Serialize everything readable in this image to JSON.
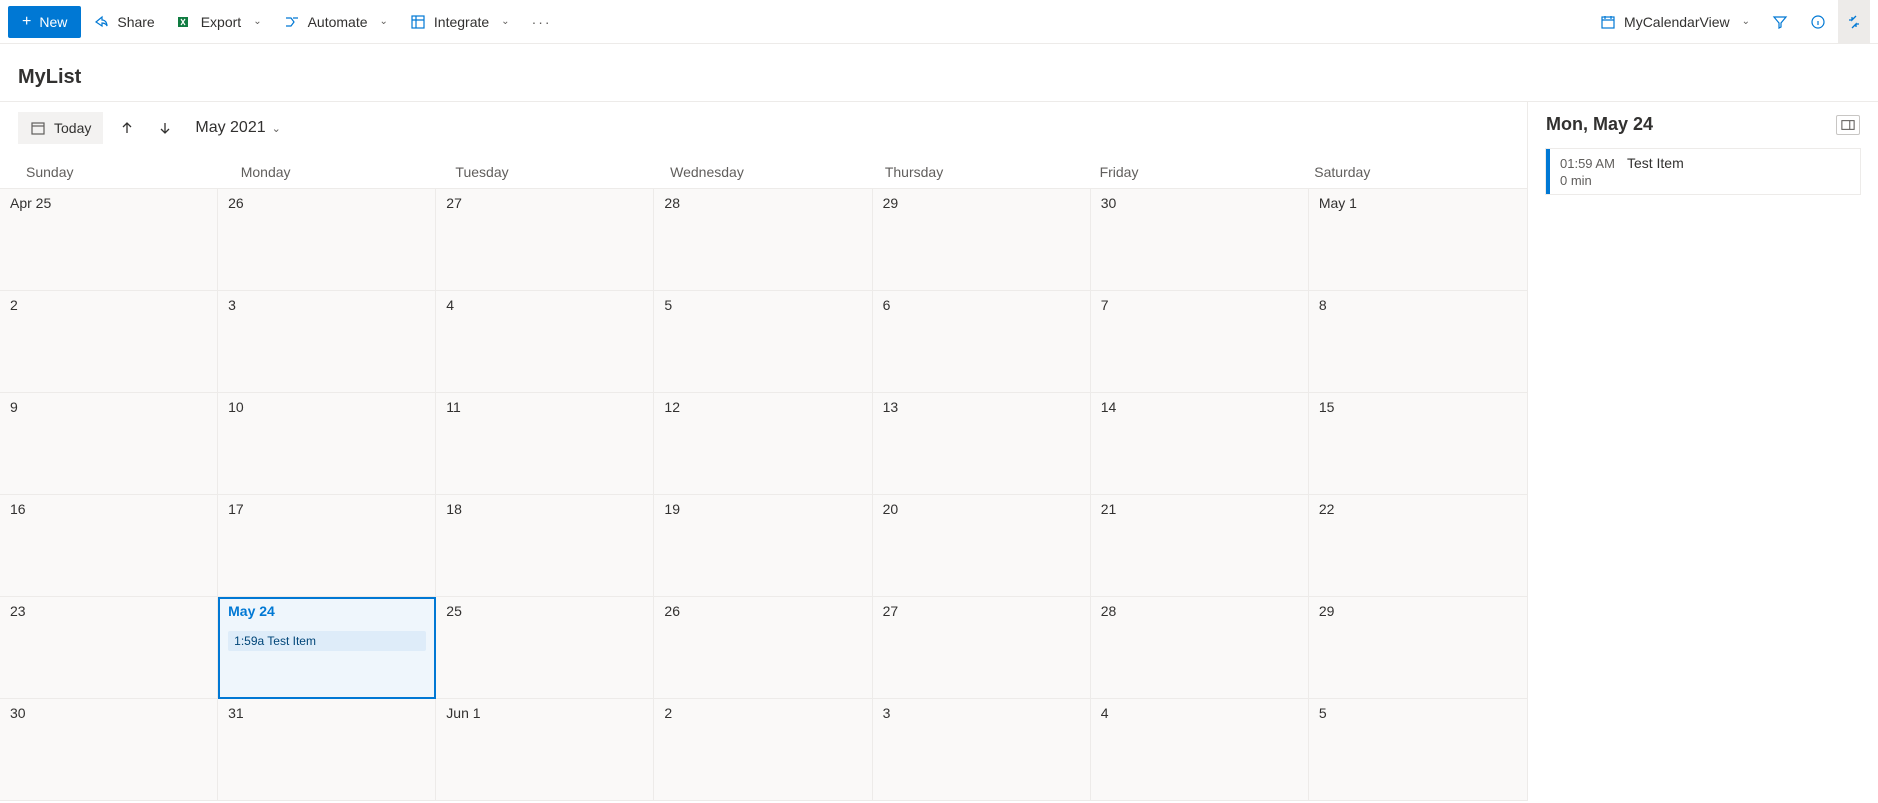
{
  "commandbar": {
    "new_label": "New",
    "share_label": "Share",
    "export_label": "Export",
    "automate_label": "Automate",
    "integrate_label": "Integrate",
    "view_name": "MyCalendarView"
  },
  "page": {
    "title": "MyList"
  },
  "calendar": {
    "today_label": "Today",
    "month_label": "May 2021",
    "weekdays": [
      "Sunday",
      "Monday",
      "Tuesday",
      "Wednesday",
      "Thursday",
      "Friday",
      "Saturday"
    ],
    "cells": [
      {
        "label": "Apr 25"
      },
      {
        "label": "26"
      },
      {
        "label": "27"
      },
      {
        "label": "28"
      },
      {
        "label": "29"
      },
      {
        "label": "30"
      },
      {
        "label": "May 1"
      },
      {
        "label": "2"
      },
      {
        "label": "3"
      },
      {
        "label": "4"
      },
      {
        "label": "5"
      },
      {
        "label": "6"
      },
      {
        "label": "7"
      },
      {
        "label": "8"
      },
      {
        "label": "9"
      },
      {
        "label": "10"
      },
      {
        "label": "11"
      },
      {
        "label": "12"
      },
      {
        "label": "13"
      },
      {
        "label": "14"
      },
      {
        "label": "15"
      },
      {
        "label": "16"
      },
      {
        "label": "17"
      },
      {
        "label": "18"
      },
      {
        "label": "19"
      },
      {
        "label": "20"
      },
      {
        "label": "21"
      },
      {
        "label": "22"
      },
      {
        "label": "23"
      },
      {
        "label": "May 24",
        "selected": true,
        "event": {
          "time": "1:59a",
          "title": "Test Item"
        }
      },
      {
        "label": "25"
      },
      {
        "label": "26"
      },
      {
        "label": "27"
      },
      {
        "label": "28"
      },
      {
        "label": "29"
      },
      {
        "label": "30"
      },
      {
        "label": "31"
      },
      {
        "label": "Jun 1"
      },
      {
        "label": "2"
      },
      {
        "label": "3"
      },
      {
        "label": "4"
      },
      {
        "label": "5"
      }
    ]
  },
  "details": {
    "date_label": "Mon, May 24",
    "items": [
      {
        "time": "01:59 AM",
        "title": "Test Item",
        "duration": "0 min"
      }
    ]
  }
}
